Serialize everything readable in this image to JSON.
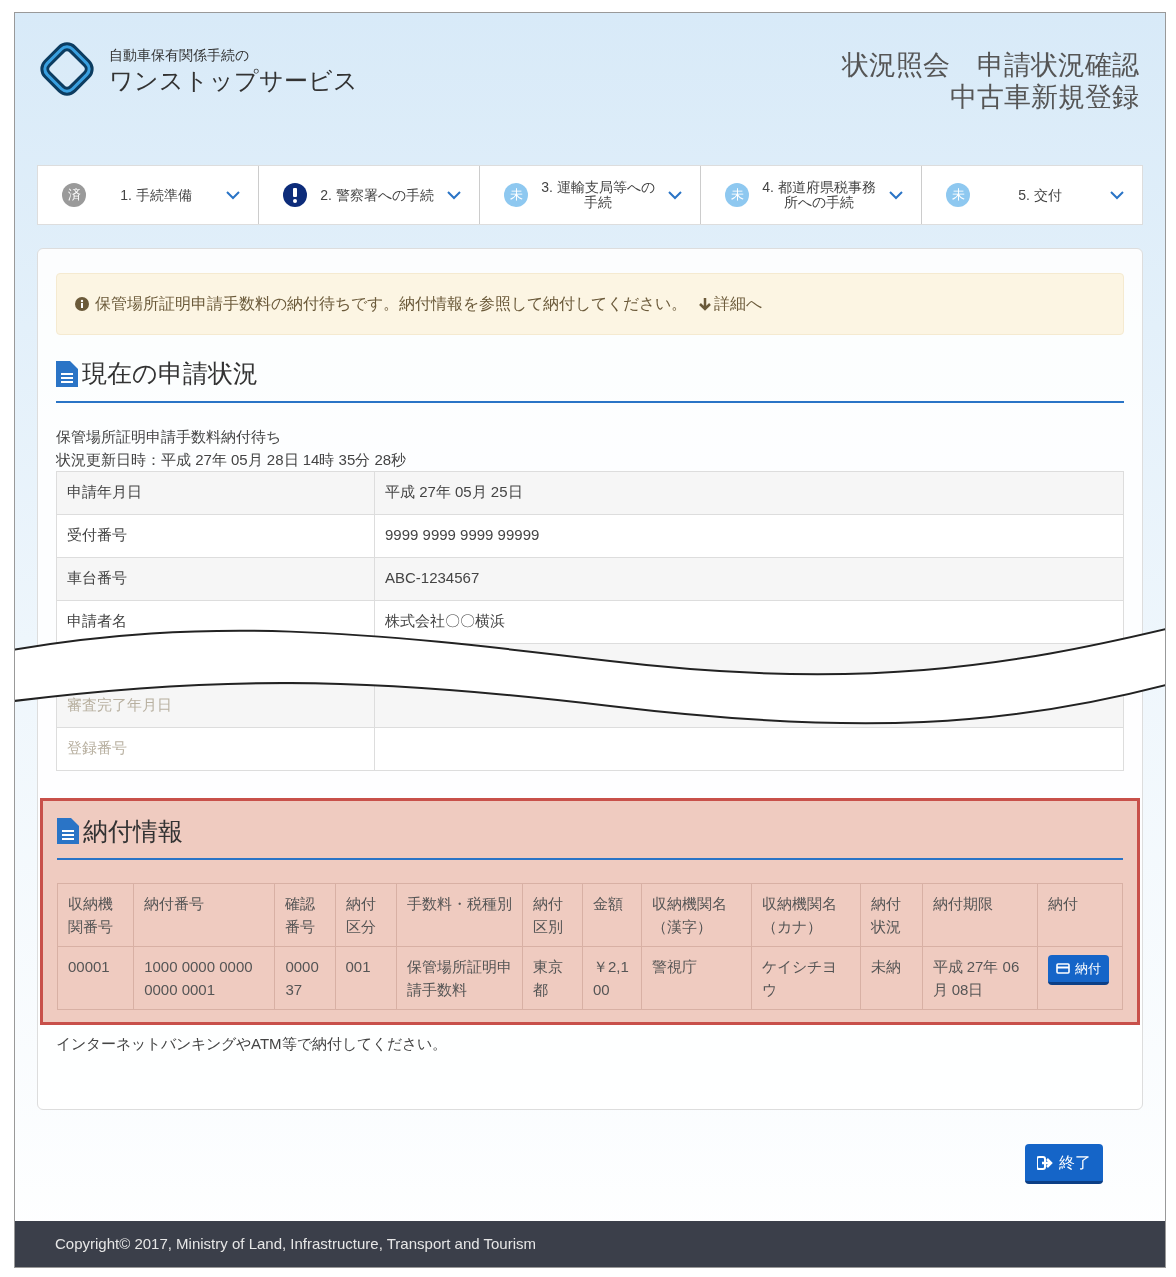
{
  "header": {
    "service_subtitle": "自動車保有関係手続の",
    "service_name": "ワンストップサービス",
    "title_line_1": "状況照会　申請状況確認",
    "title_line_2": "中古車新規登録"
  },
  "steps": [
    {
      "label": "1. 手続準備",
      "kind": "done",
      "badge": "済"
    },
    {
      "label": "2. 警察署への手続",
      "kind": "alert"
    },
    {
      "label": "3. 運輸支局等への手続",
      "kind": "todo",
      "badge": "未"
    },
    {
      "label": "4. 都道府県税事務所への手続",
      "kind": "todo",
      "badge": "未"
    },
    {
      "label": "5. 交付",
      "kind": "todo",
      "badge": "未"
    }
  ],
  "alert": {
    "message": "保管場所証明申請手数料の納付待ちです。納付情報を参照して納付してください。",
    "link": "詳細へ"
  },
  "current_status": {
    "heading": "現在の申請状況",
    "status_text": "保管場所証明申請手数料納付待ち",
    "updated": "状況更新日時：平成 27年 05月 28日 14時 35分 28秒",
    "rows": [
      {
        "label": "申請年月日",
        "value": "平成 27年 05月 25日",
        "muted": false
      },
      {
        "label": "受付番号",
        "value": "9999 9999 9999 99999",
        "muted": false
      },
      {
        "label": "車台番号",
        "value": "ABC-1234567",
        "muted": false
      },
      {
        "label": "申請者名",
        "value": "株式会社〇〇横浜",
        "muted": false
      },
      {
        "label": "審査完了年月日",
        "muted": true
      },
      {
        "label": "登録番号",
        "muted": true
      }
    ]
  },
  "payment": {
    "heading": "納付情報",
    "columns": [
      "収納機関番号",
      "納付番号",
      "確認番号",
      "納付区分",
      "手数料・税種別",
      "納付区別",
      "金額",
      "収納機関名（漢字）",
      "収納機関名（カナ）",
      "納付状況",
      "納付期限",
      "納付"
    ],
    "rows": [
      {
        "cells": [
          "00001",
          "1000 0000 0000 0000 0001",
          "000037",
          "001",
          "保管場所証明申請手数料",
          "東京都",
          "￥2,100",
          "警視庁",
          "ケイシチヨウ",
          "未納",
          "平成 27年 06月 08日"
        ],
        "button": "納付"
      }
    ],
    "note": "インターネットバンキングやATM等で納付してください。"
  },
  "end_button": "終了",
  "footer": "Copyright© 2017, Ministry of Land, Infrastructure, Transport and Tourism"
}
